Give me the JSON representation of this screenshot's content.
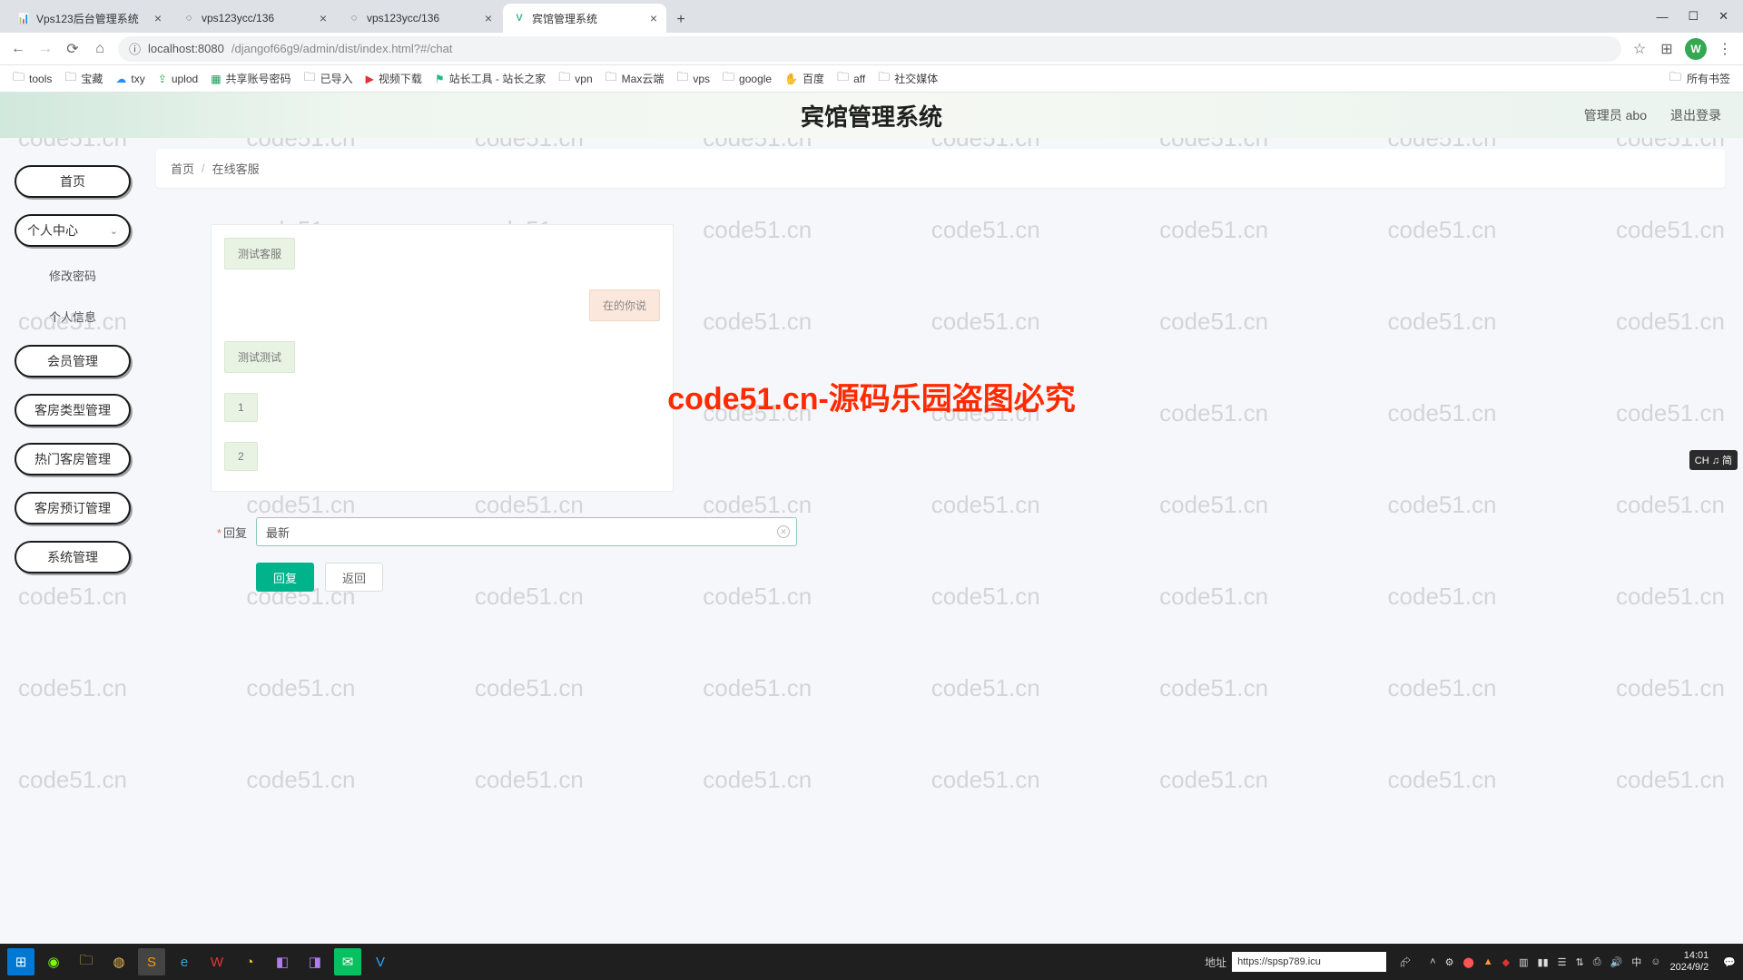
{
  "browser": {
    "tabs": [
      {
        "icon": "📊",
        "title": "Vps123后台管理系统"
      },
      {
        "icon": "⎇",
        "title": "vps123ycc/136"
      },
      {
        "icon": "⎇",
        "title": "vps123ycc/136"
      },
      {
        "icon": "V",
        "title": "宾馆管理系统",
        "active": true
      }
    ],
    "url_prefix": "localhost:8080",
    "url_path": "/djangof66g9/admin/dist/index.html?#/chat",
    "avatar_letter": "W",
    "bookmarks": [
      "tools",
      "宝藏",
      "txy",
      "uplod",
      "共享账号密码",
      "已导入",
      "视频下载",
      "站长工具 - 站长之家",
      "vpn",
      "Max云端",
      "vps",
      "google",
      "百度",
      "aff",
      "社交媒体"
    ],
    "bookmarks_right": "所有书签"
  },
  "app": {
    "title": "宾馆管理系统",
    "header_user": "管理员 abo",
    "header_logout": "退出登录"
  },
  "sidebar": {
    "home": "首页",
    "personal": "个人中心",
    "sub": {
      "pwd": "修改密码",
      "info": "个人信息"
    },
    "member": "会员管理",
    "roomtype": "客房类型管理",
    "hotroom": "热门客房管理",
    "booking": "客房预订管理",
    "system": "系统管理"
  },
  "breadcrumb": {
    "home": "首页",
    "current": "在线客服"
  },
  "chat": {
    "msgs": [
      {
        "side": "left",
        "text": "测试客服"
      },
      {
        "side": "right",
        "text": "在的你说"
      },
      {
        "side": "left",
        "text": "测试测试"
      },
      {
        "side": "left",
        "text": "1"
      },
      {
        "side": "left",
        "text": "2"
      }
    ]
  },
  "form": {
    "label": "回复",
    "value": "最新",
    "btn_reply": "回复",
    "btn_back": "返回"
  },
  "watermark": {
    "text": "code51.cn",
    "center": "code51.cn-源码乐园盗图必究"
  },
  "ime_badge": "CH ♫ 简",
  "taskbar": {
    "addr_label": "地址",
    "addr_value": "https://spsp789.icu",
    "time": "14:01",
    "date": "2024/9/2"
  }
}
